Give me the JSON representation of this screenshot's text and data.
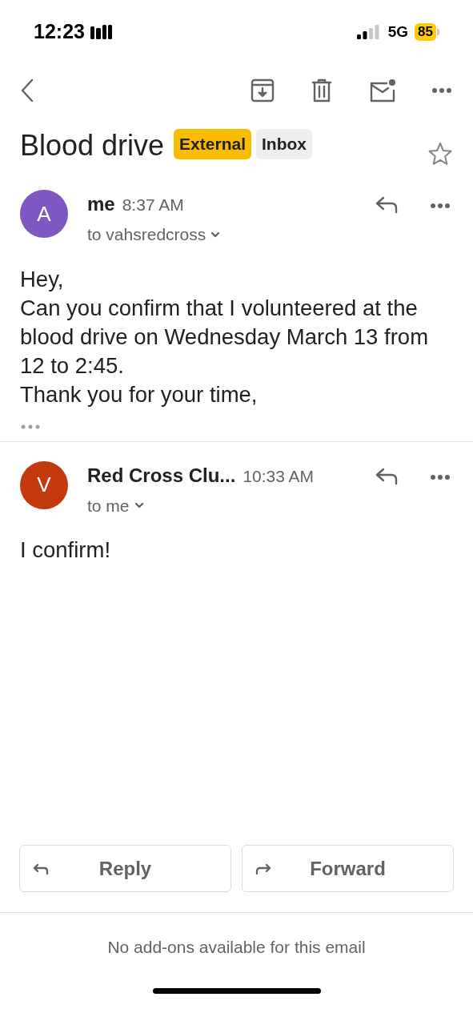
{
  "status_bar": {
    "time": "12:23",
    "network": "5G",
    "battery": "85"
  },
  "subject": "Blood drive",
  "labels": [
    {
      "text": "External",
      "color": "#fbbc04"
    },
    {
      "text": "Inbox",
      "color": "#eeeeee"
    }
  ],
  "starred": false,
  "messages": [
    {
      "avatar": "A",
      "color": "#7e57c2",
      "sender": "me",
      "time": "8:37 AM",
      "recipient": "to vahsredcross",
      "body": [
        "Hey,",
        "Can you confirm that I volunteered at the blood drive on Wednesday March 13 from 12 to 2:45.",
        "Thank you for your time,"
      ],
      "quoted_hidden": true
    },
    {
      "avatar": "V",
      "color": "#c5390f",
      "sender": "Red Cross Clu...",
      "time": "10:33 AM",
      "recipient": "to me",
      "body": [
        "I confirm!"
      ],
      "quoted_hidden": false
    }
  ],
  "actions": [
    "Reply",
    "Forward"
  ],
  "footer": "No add-ons available for this email"
}
